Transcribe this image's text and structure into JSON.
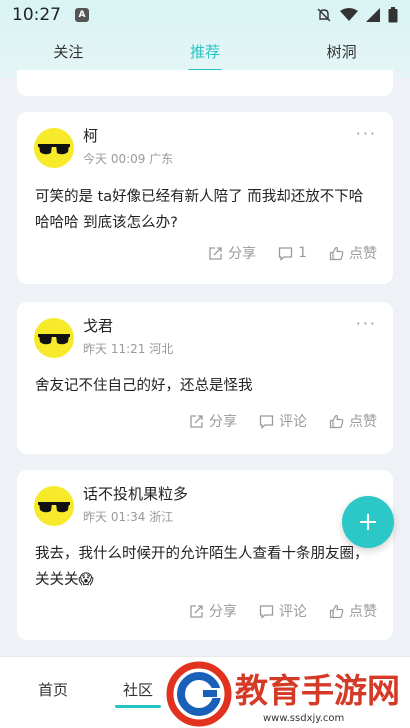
{
  "status": {
    "time": "10:27",
    "app_icon": "A"
  },
  "tabs": [
    {
      "label": "关注"
    },
    {
      "label": "推荐"
    },
    {
      "label": "树洞"
    }
  ],
  "posts": [
    {
      "name": "柯",
      "meta": "今天 00:09 广东",
      "text": "可笑的是 ta好像已经有新人陪了 而我却还放不下哈哈哈哈 到底该怎么办?",
      "share": "分享",
      "comment": "1",
      "like": "点赞"
    },
    {
      "name": "戈君",
      "meta": "昨天 11:21 河北",
      "text": "舍友记不住自己的好，还总是怪我",
      "share": "分享",
      "comment": "评论",
      "like": "点赞"
    },
    {
      "name": "话不投机果粒多",
      "meta": "昨天 01:34 浙江",
      "text": "我去，我什么时候开的允许陌生人查看十条朋友圈，关关关😱",
      "share": "分享",
      "comment": "评论",
      "like": "点赞"
    }
  ],
  "more_glyph": "···",
  "bottom_nav": [
    {
      "label": "首页"
    },
    {
      "label": "社区"
    }
  ],
  "watermark": {
    "title": "教育手游网",
    "url": "www.ssdxjy.com"
  },
  "colors": {
    "accent": "#27c4c4",
    "avatar_bg": "#f7ea2a"
  }
}
